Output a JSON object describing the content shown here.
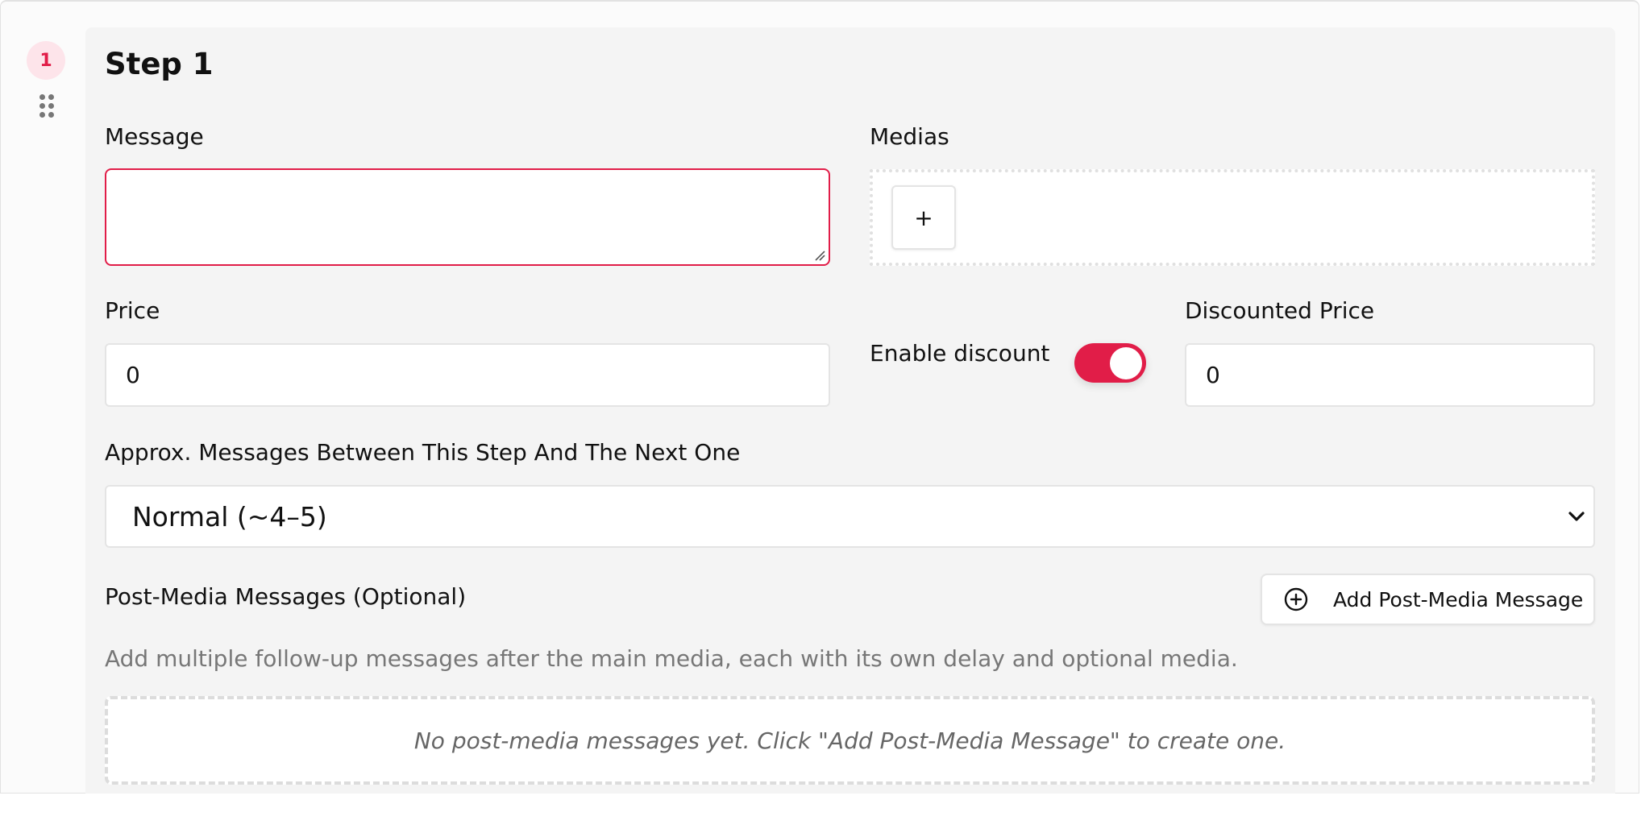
{
  "step": {
    "number": "1",
    "title": "Step 1"
  },
  "message": {
    "label": "Message",
    "value": ""
  },
  "medias": {
    "label": "Medias",
    "add_symbol": "+"
  },
  "price": {
    "label": "Price",
    "value": "0"
  },
  "discount": {
    "toggle_label": "Enable discount",
    "enabled": true,
    "price_label": "Discounted Price",
    "price_value": "0"
  },
  "frequency": {
    "label": "Approx. Messages Between This Step And The Next One",
    "selected": "Normal (~4–5)"
  },
  "post_media": {
    "title": "Post-Media Messages (Optional)",
    "add_button_label": "Add Post-Media Message",
    "hint": "Add multiple follow-up messages after the main media, each with its own delay and optional media.",
    "empty_text": "No post-media messages yet. Click \"Add Post-Media Message\" to create one."
  },
  "colors": {
    "accent": "#e11d48",
    "badge_bg": "#fde4ea",
    "card_bg": "#f4f4f4"
  },
  "icons": {
    "drag": "drag-handle-icon",
    "add": "plus-circle-icon",
    "chevron": "chevron-down-icon"
  }
}
